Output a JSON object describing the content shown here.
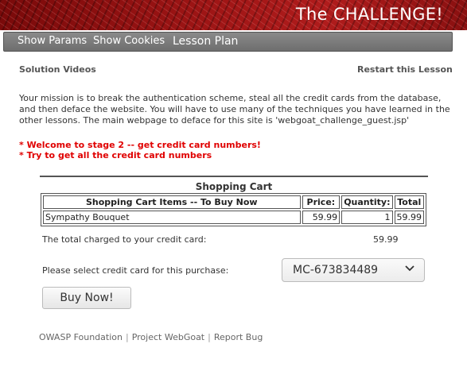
{
  "banner": {
    "title": "The CHALLENGE!"
  },
  "nav": {
    "items": [
      "Show Params",
      "Show Cookies",
      "Lesson Plan"
    ]
  },
  "links": {
    "solution_videos": "Solution Videos",
    "restart_lesson": "Restart this Lesson"
  },
  "mission": "Your mission is to break the authentication scheme, steal all the credit cards from the database, and then deface the website. You will have to use many of the techniques you have learned in the other lessons. The main webpage to deface for this site is 'webgoat_challenge_guest.jsp'",
  "alerts": [
    "* Welcome to stage 2 -- get credit card numbers!",
    "* Try to get all the credit card numbers"
  ],
  "cart": {
    "title": "Shopping Cart",
    "headers": [
      "Shopping Cart Items -- To Buy Now",
      "Price:",
      "Quantity:",
      "Total"
    ],
    "rows": [
      [
        "Sympathy Bouquet",
        "59.99",
        "1",
        "59.99"
      ]
    ]
  },
  "total": {
    "label": "The total charged to your credit card:",
    "value": "59.99"
  },
  "card_select": {
    "label": "Please select credit card for this purchase:",
    "value": "MC-673834489"
  },
  "buy_button": "Buy Now!",
  "footer": [
    "OWASP Foundation",
    "Project WebGoat",
    "Report Bug"
  ],
  "colors": {
    "banner": "#9b1414",
    "navbar": "#7a7a7a",
    "alert": "#e00000"
  },
  "icons": {
    "select": "chevron-down-icon"
  }
}
